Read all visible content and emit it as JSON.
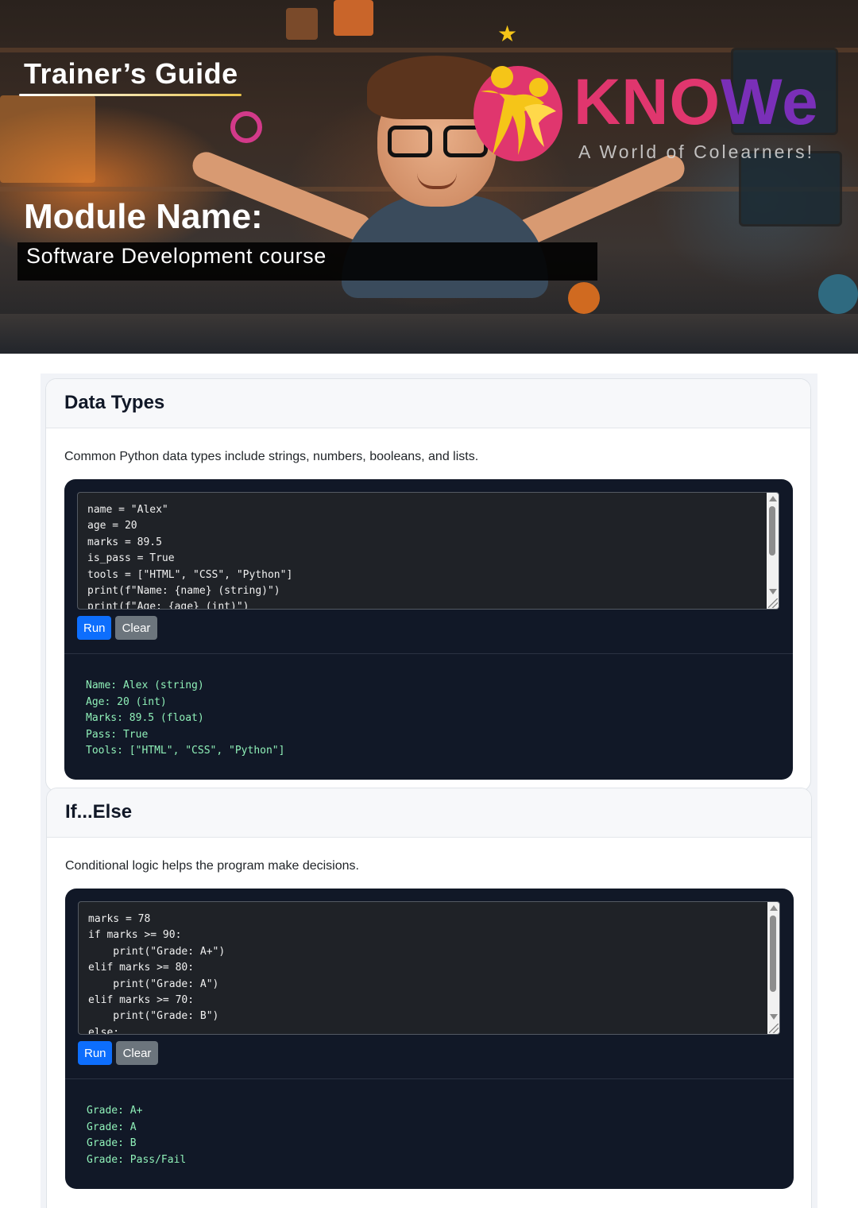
{
  "hero": {
    "guide_title": "Trainer’s Guide",
    "module_label": "Module Name:",
    "module_value": "Software Development course",
    "logo": {
      "brand_a": "KNO",
      "brand_b": "We",
      "tagline": "A World of Colearners!",
      "colors": {
        "primary": "#e0366e",
        "secondary": "#7a2fb8",
        "star": "#f5c518"
      }
    }
  },
  "sections": [
    {
      "title": "Data Types",
      "description": "Common Python data types include strings, numbers, booleans, and lists.",
      "code": "name = \"Alex\"\nage = 20\nmarks = 89.5\nis_pass = True\ntools = [\"HTML\", \"CSS\", \"Python\"]\nprint(f\"Name: {name} (string)\")\nprint(f\"Age: {age} (int)\")",
      "run_label": "Run",
      "clear_label": "Clear",
      "output": "Name: Alex (string)\nAge: 20 (int)\nMarks: 89.5 (float)\nPass: True\nTools: [\"HTML\", \"CSS\", \"Python\"]"
    },
    {
      "title": "If...Else",
      "description": "Conditional logic helps the program make decisions.",
      "code": "marks = 78\nif marks >= 90:\n    print(\"Grade: A+\")\nelif marks >= 80:\n    print(\"Grade: A\")\nelif marks >= 70:\n    print(\"Grade: B\")\nelse:",
      "run_label": "Run",
      "clear_label": "Clear",
      "output": "Grade: A+\nGrade: A\nGrade: B\nGrade: Pass/Fail"
    }
  ],
  "colors": {
    "run_button": "#0d6efd",
    "clear_button": "#6c757d",
    "panel_bg": "#111827",
    "output_text": "#8ff0b8"
  }
}
